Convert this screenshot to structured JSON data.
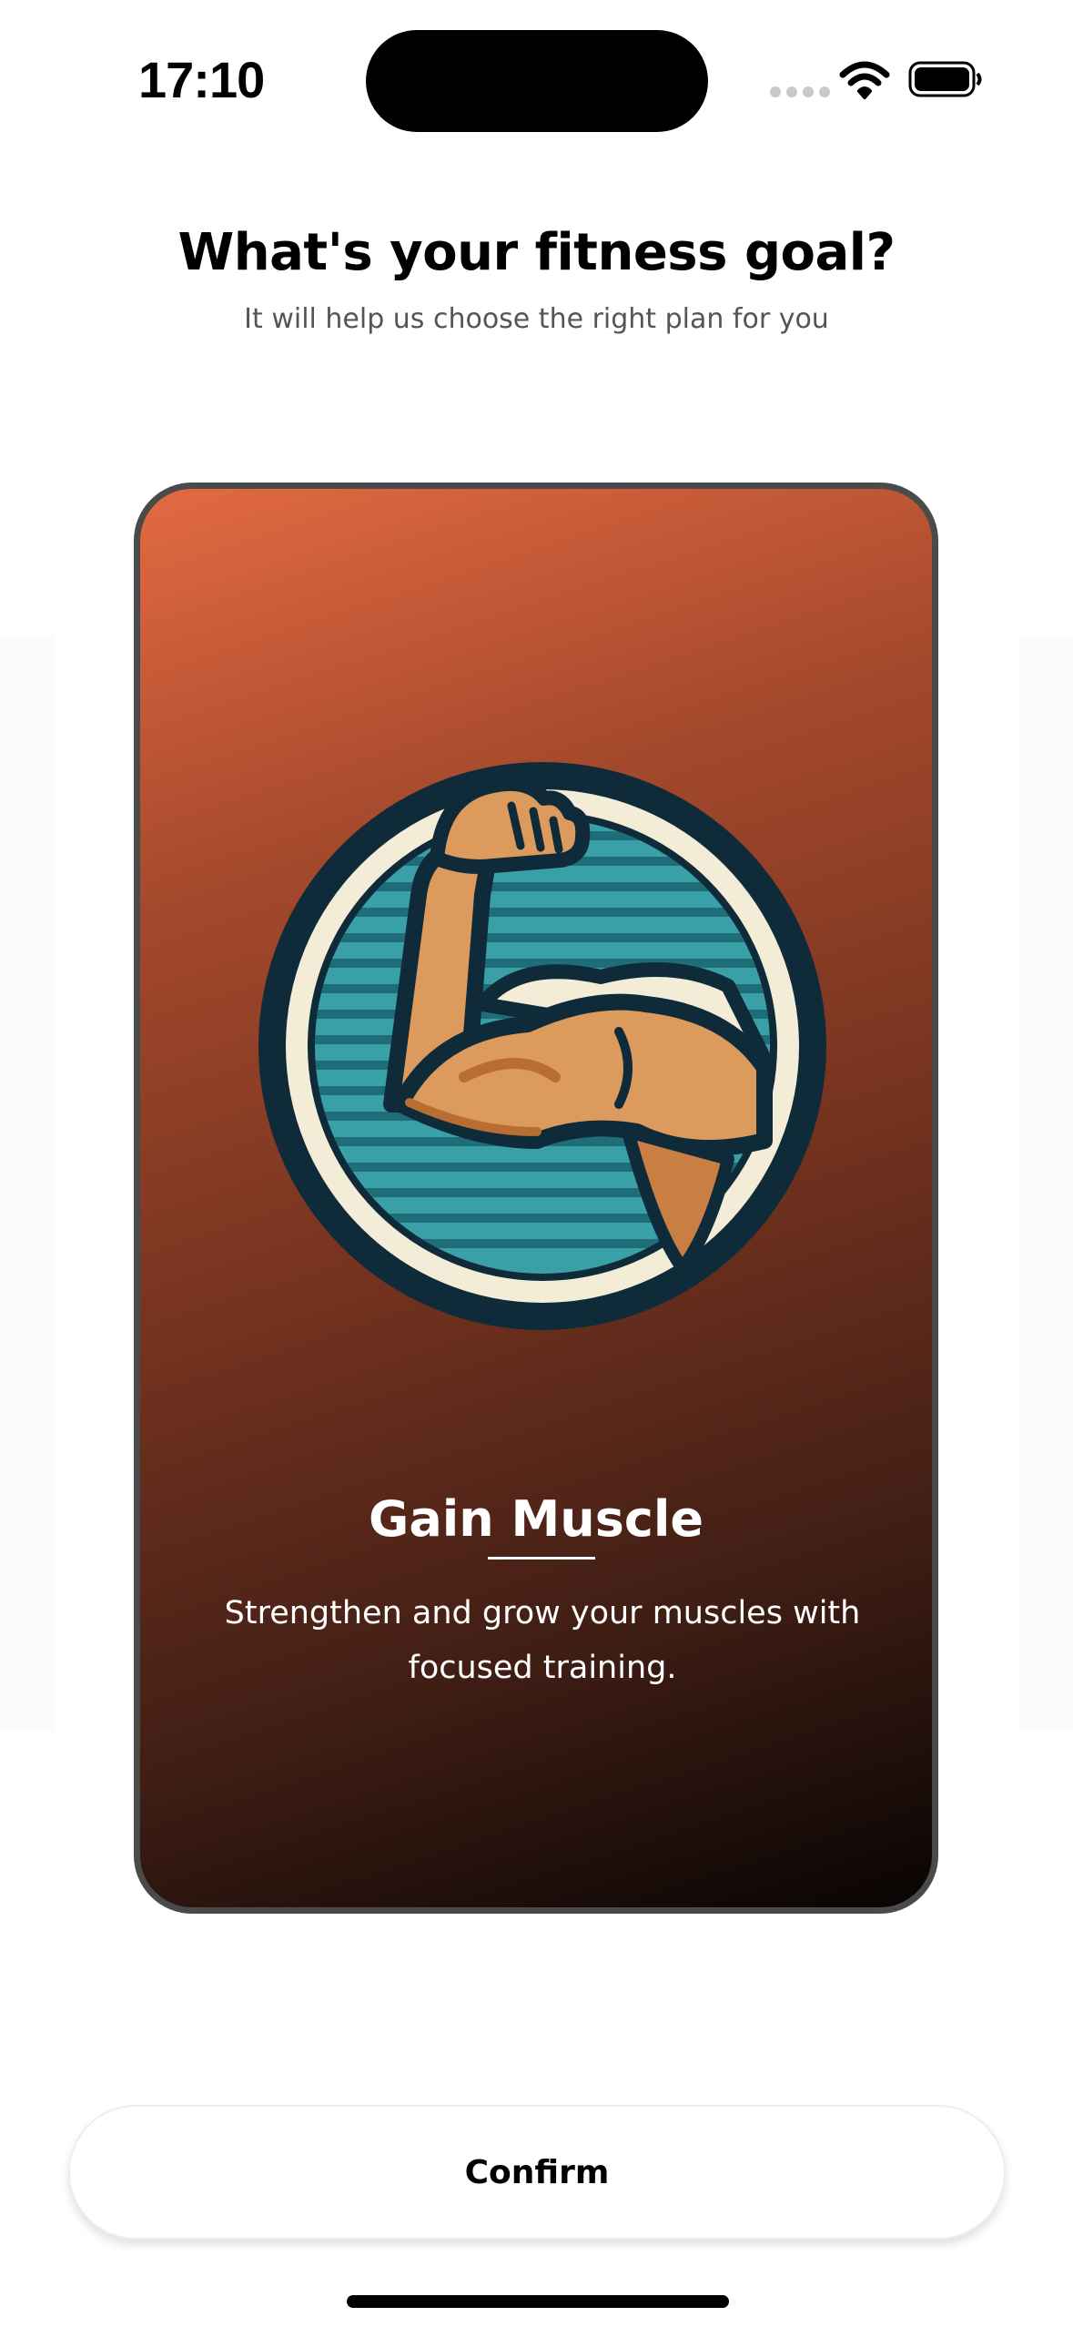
{
  "status_bar": {
    "time": "17:10",
    "icons": [
      "signal-dots-icon",
      "wifi-icon",
      "battery-icon"
    ]
  },
  "header": {
    "title": "What's your fitness goal?",
    "subtitle": "It will help us choose the right plan for you"
  },
  "selected_goal": {
    "title": "Gain Muscle",
    "description": "Strengthen and grow your muscles with focused training.",
    "icon": "flexed-bicep-icon",
    "gradient_colors": [
      "#e36a42",
      "#73321f",
      "#080403"
    ]
  },
  "actions": {
    "confirm_label": "Confirm"
  },
  "colors": {
    "emblem_teal": "#3aa0a8",
    "emblem_navy": "#0f2b3a",
    "emblem_cream": "#f3edd8",
    "skin": "#dc9a5c"
  }
}
